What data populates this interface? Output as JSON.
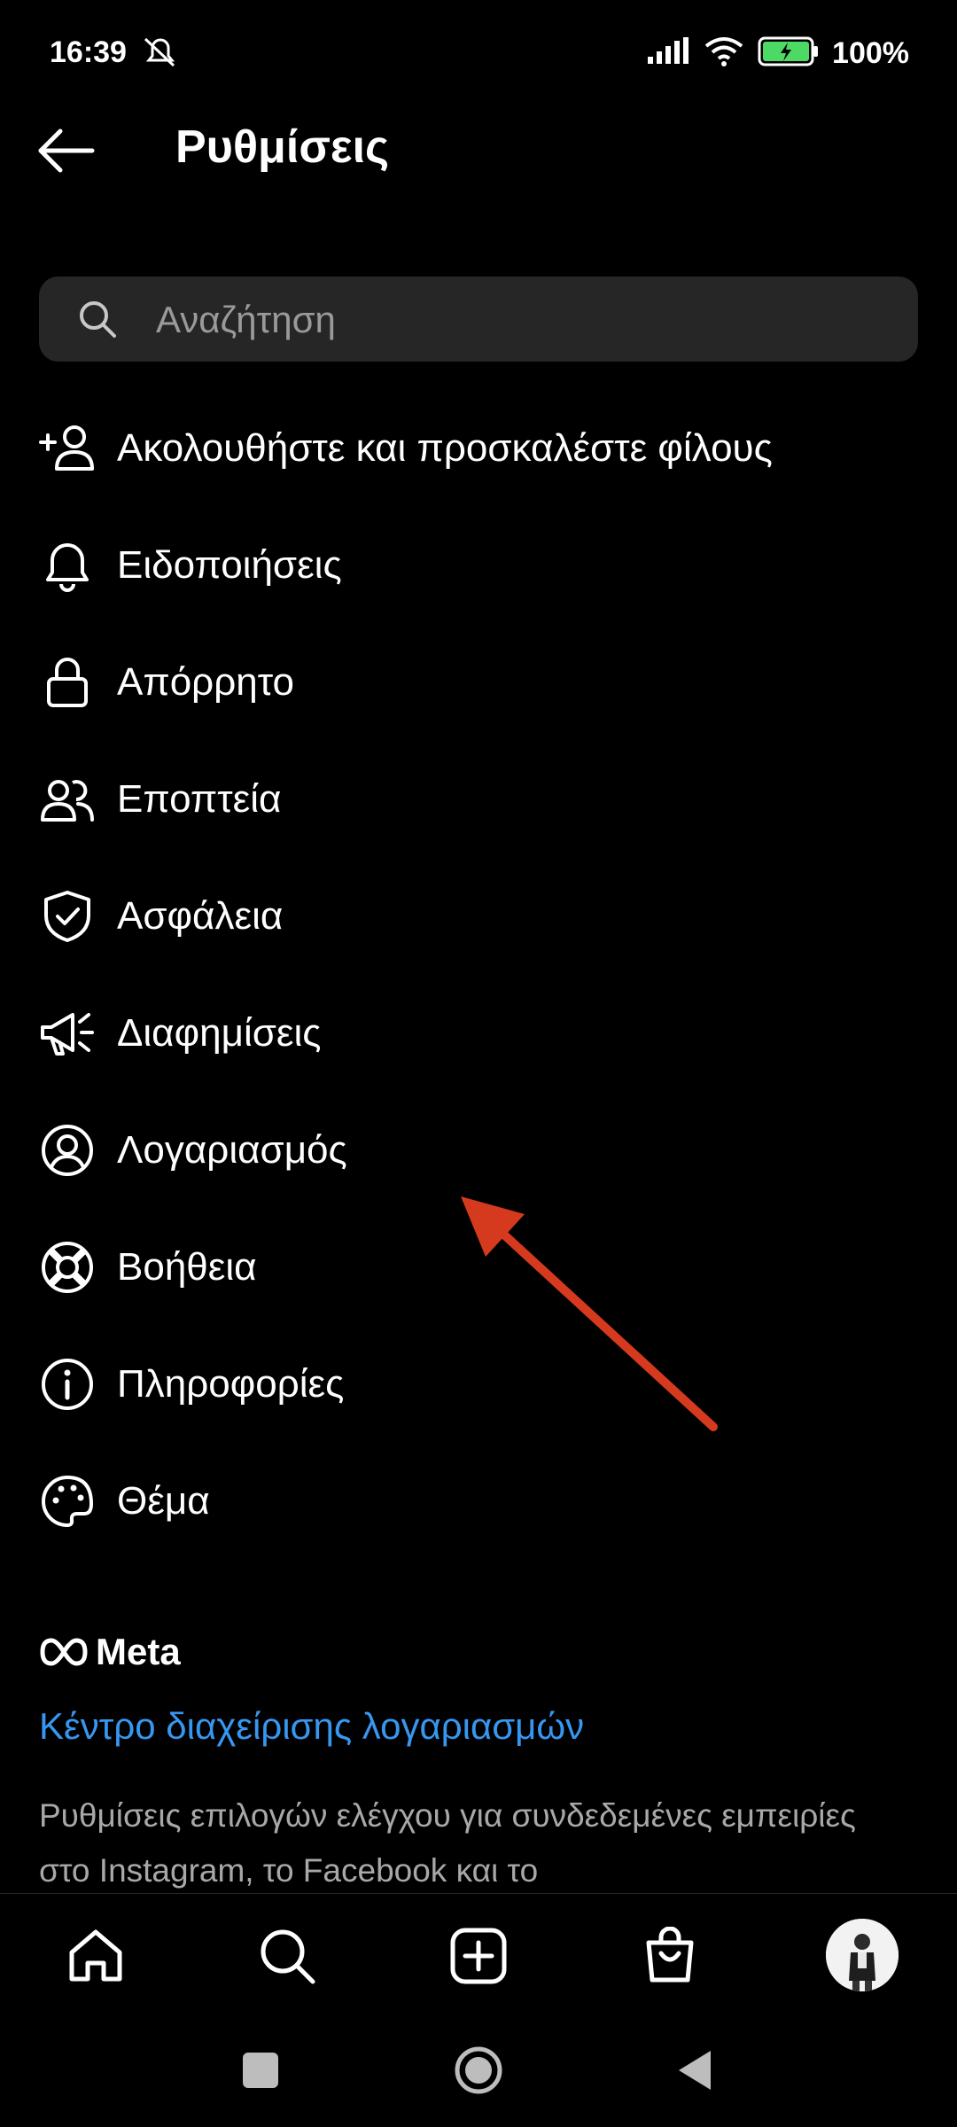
{
  "status": {
    "time": "16:39",
    "battery": "100%"
  },
  "header": {
    "title": "Ρυθμίσεις",
    "back_icon": "arrow-left-icon"
  },
  "search": {
    "placeholder": "Αναζήτηση",
    "icon": "search-icon"
  },
  "menu": {
    "items": [
      {
        "label": "Ακολουθήστε και προσκαλέστε φίλους",
        "icon": "add-person-icon"
      },
      {
        "label": "Ειδοποιήσεις",
        "icon": "bell-icon"
      },
      {
        "label": "Απόρρητο",
        "icon": "lock-icon"
      },
      {
        "label": "Εποπτεία",
        "icon": "people-icon"
      },
      {
        "label": "Ασφάλεια",
        "icon": "shield-check-icon"
      },
      {
        "label": "Διαφημίσεις",
        "icon": "megaphone-icon"
      },
      {
        "label": "Λογαριασμός",
        "icon": "account-icon"
      },
      {
        "label": "Βοήθεια",
        "icon": "lifebuoy-icon"
      },
      {
        "label": "Πληροφορίες",
        "icon": "info-icon"
      },
      {
        "label": "Θέμα",
        "icon": "palette-icon"
      }
    ]
  },
  "meta": {
    "brand": "Meta",
    "accounts_center": "Κέντρο διαχείρισης λογαριασμών",
    "description": "Ρυθμίσεις επιλογών ελέγχου για συνδεδεμένες εμπειρίες στο Instagram, το Facebook και το"
  },
  "colors": {
    "background": "#000000",
    "accent_link": "#3797f0",
    "annotation_arrow": "#d63a1e"
  }
}
